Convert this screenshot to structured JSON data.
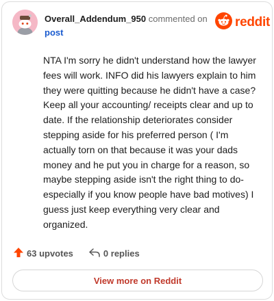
{
  "comment": {
    "author": "Overall_Addendum_950",
    "meta_text": "commented on",
    "post_link": "post",
    "body": "NTA I'm sorry he didn't understand how the lawyer fees will work. INFO did his lawyers explain to him they were quitting because he didn't have a case? Keep all your accounting/ receipts clear and up to date. If the relationship deteriorates consider stepping aside for his preferred person ( I'm actually torn on that because it was your dads money and he put you in charge for a reason, so maybe stepping aside isn't the right thing to do- especially if you know people have bad motives) I guess just keep everything very clear and organized.",
    "avatar_icon": "snoo-avatar-icon",
    "avatar_color": "#f5b8c6"
  },
  "brand": {
    "name": "reddit",
    "icon": "reddit-logo-icon",
    "color": "#ff4500"
  },
  "actions": {
    "upvotes_label": "63 upvotes",
    "upvote_icon": "upvote-arrow-icon",
    "replies_label": "0 replies",
    "reply_icon": "reply-icon"
  },
  "footer": {
    "view_more_label": "View more on Reddit"
  }
}
